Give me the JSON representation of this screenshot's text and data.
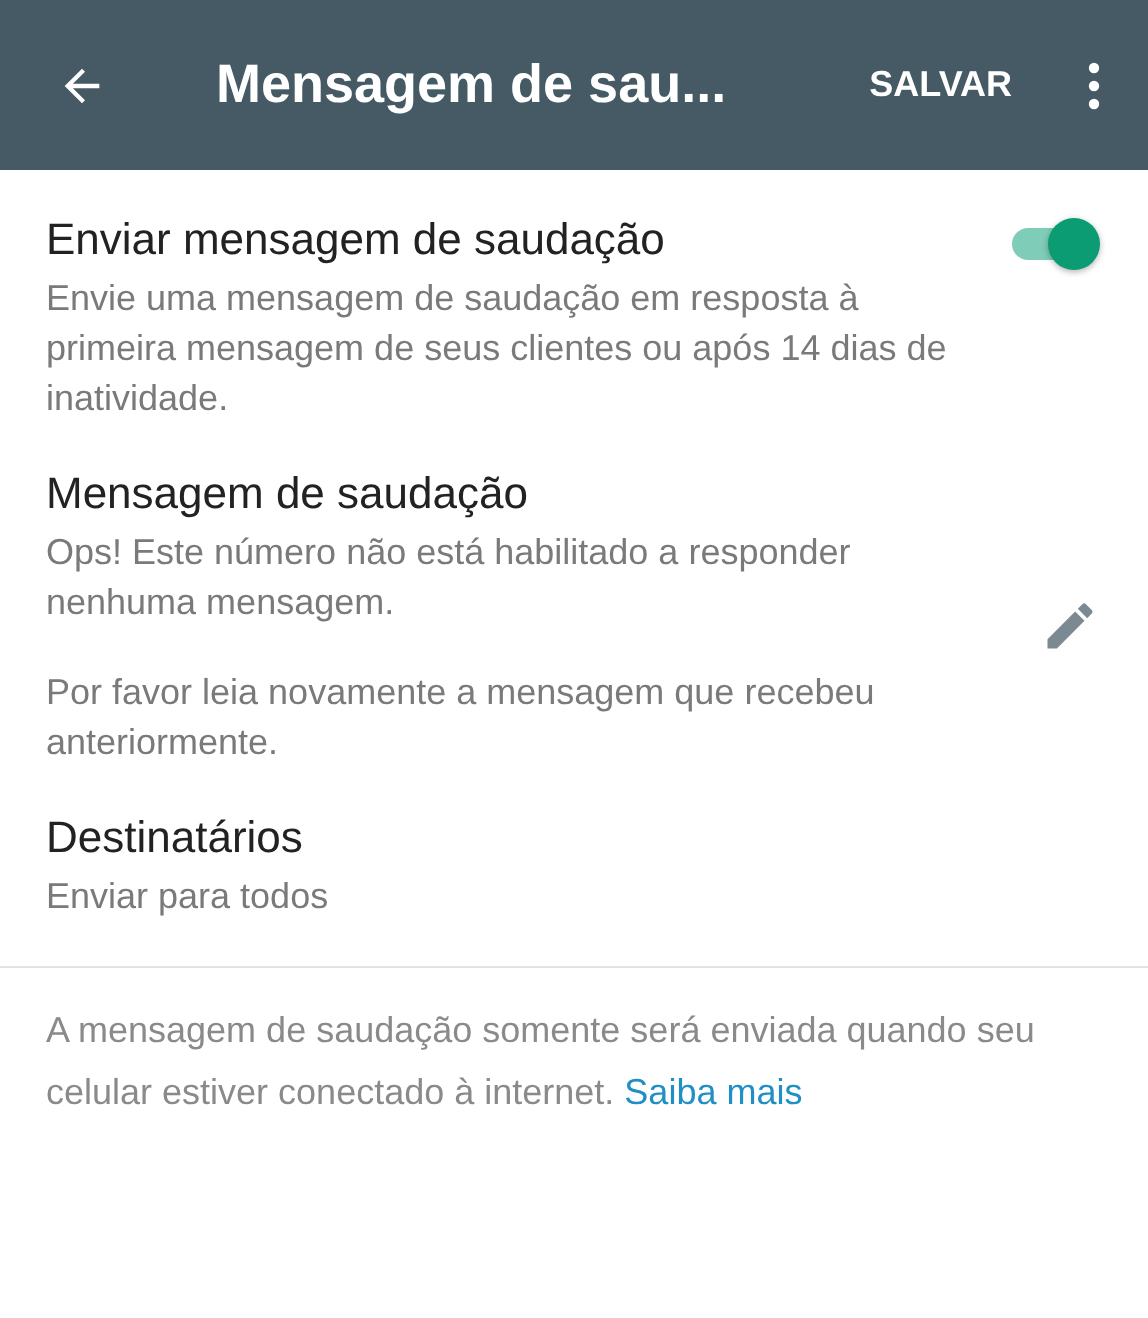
{
  "app_bar": {
    "title": "Mensagem de sau...",
    "action": "SALVAR"
  },
  "settings": [
    {
      "kind": "toggle",
      "title": "Enviar mensagem de saudação",
      "paragraphs": [
        "Envie uma mensagem de saudação em resposta à primeira mensagem de seus clientes ou após 14 dias de inatividade."
      ],
      "on": true
    },
    {
      "kind": "edit",
      "title": "Mensagem de saudação",
      "paragraphs": [
        "Ops! Este número não está habilitado a responder nenhuma mensagem.",
        "Por favor leia novamente a mensagem que recebeu anteriormente."
      ]
    },
    {
      "kind": "plain",
      "title": "Destinatários",
      "paragraphs": [
        "Enviar para todos"
      ]
    }
  ],
  "footer": {
    "text": "A mensagem de saudação somente será enviada quando seu celular estiver conectado à internet.",
    "link": "Saiba mais"
  }
}
